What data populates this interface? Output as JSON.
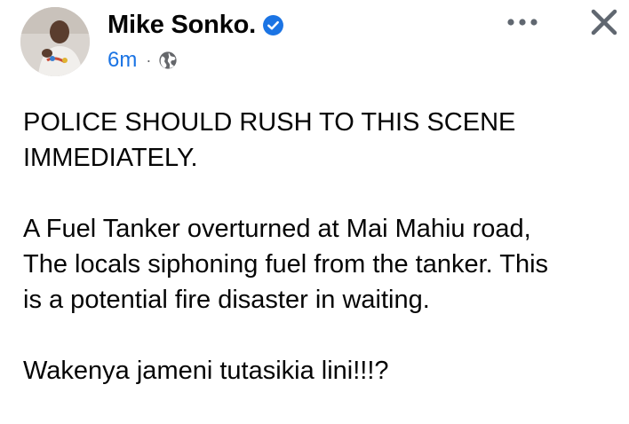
{
  "post": {
    "author_name": "Mike Sonko.",
    "timestamp": "6m",
    "meta_separator": "·",
    "paragraphs": [
      "POLICE SHOULD RUSH TO THIS SCENE\nIMMEDIATELY.",
      "A Fuel Tanker overturned at Mai Mahiu road,\nThe locals siphoning fuel from the tanker.  This\nis a potential fire disaster in waiting.",
      "Wakenya jameni tutasikia lini!!!?"
    ]
  },
  "icons": {
    "verified": "verified-badge-icon",
    "audience": "globe-icon",
    "more": "more-options-icon",
    "close": "close-icon"
  },
  "colors": {
    "accent": "#1b74e4",
    "text": "#050505",
    "muted": "#65676b",
    "icon": "#606770"
  }
}
